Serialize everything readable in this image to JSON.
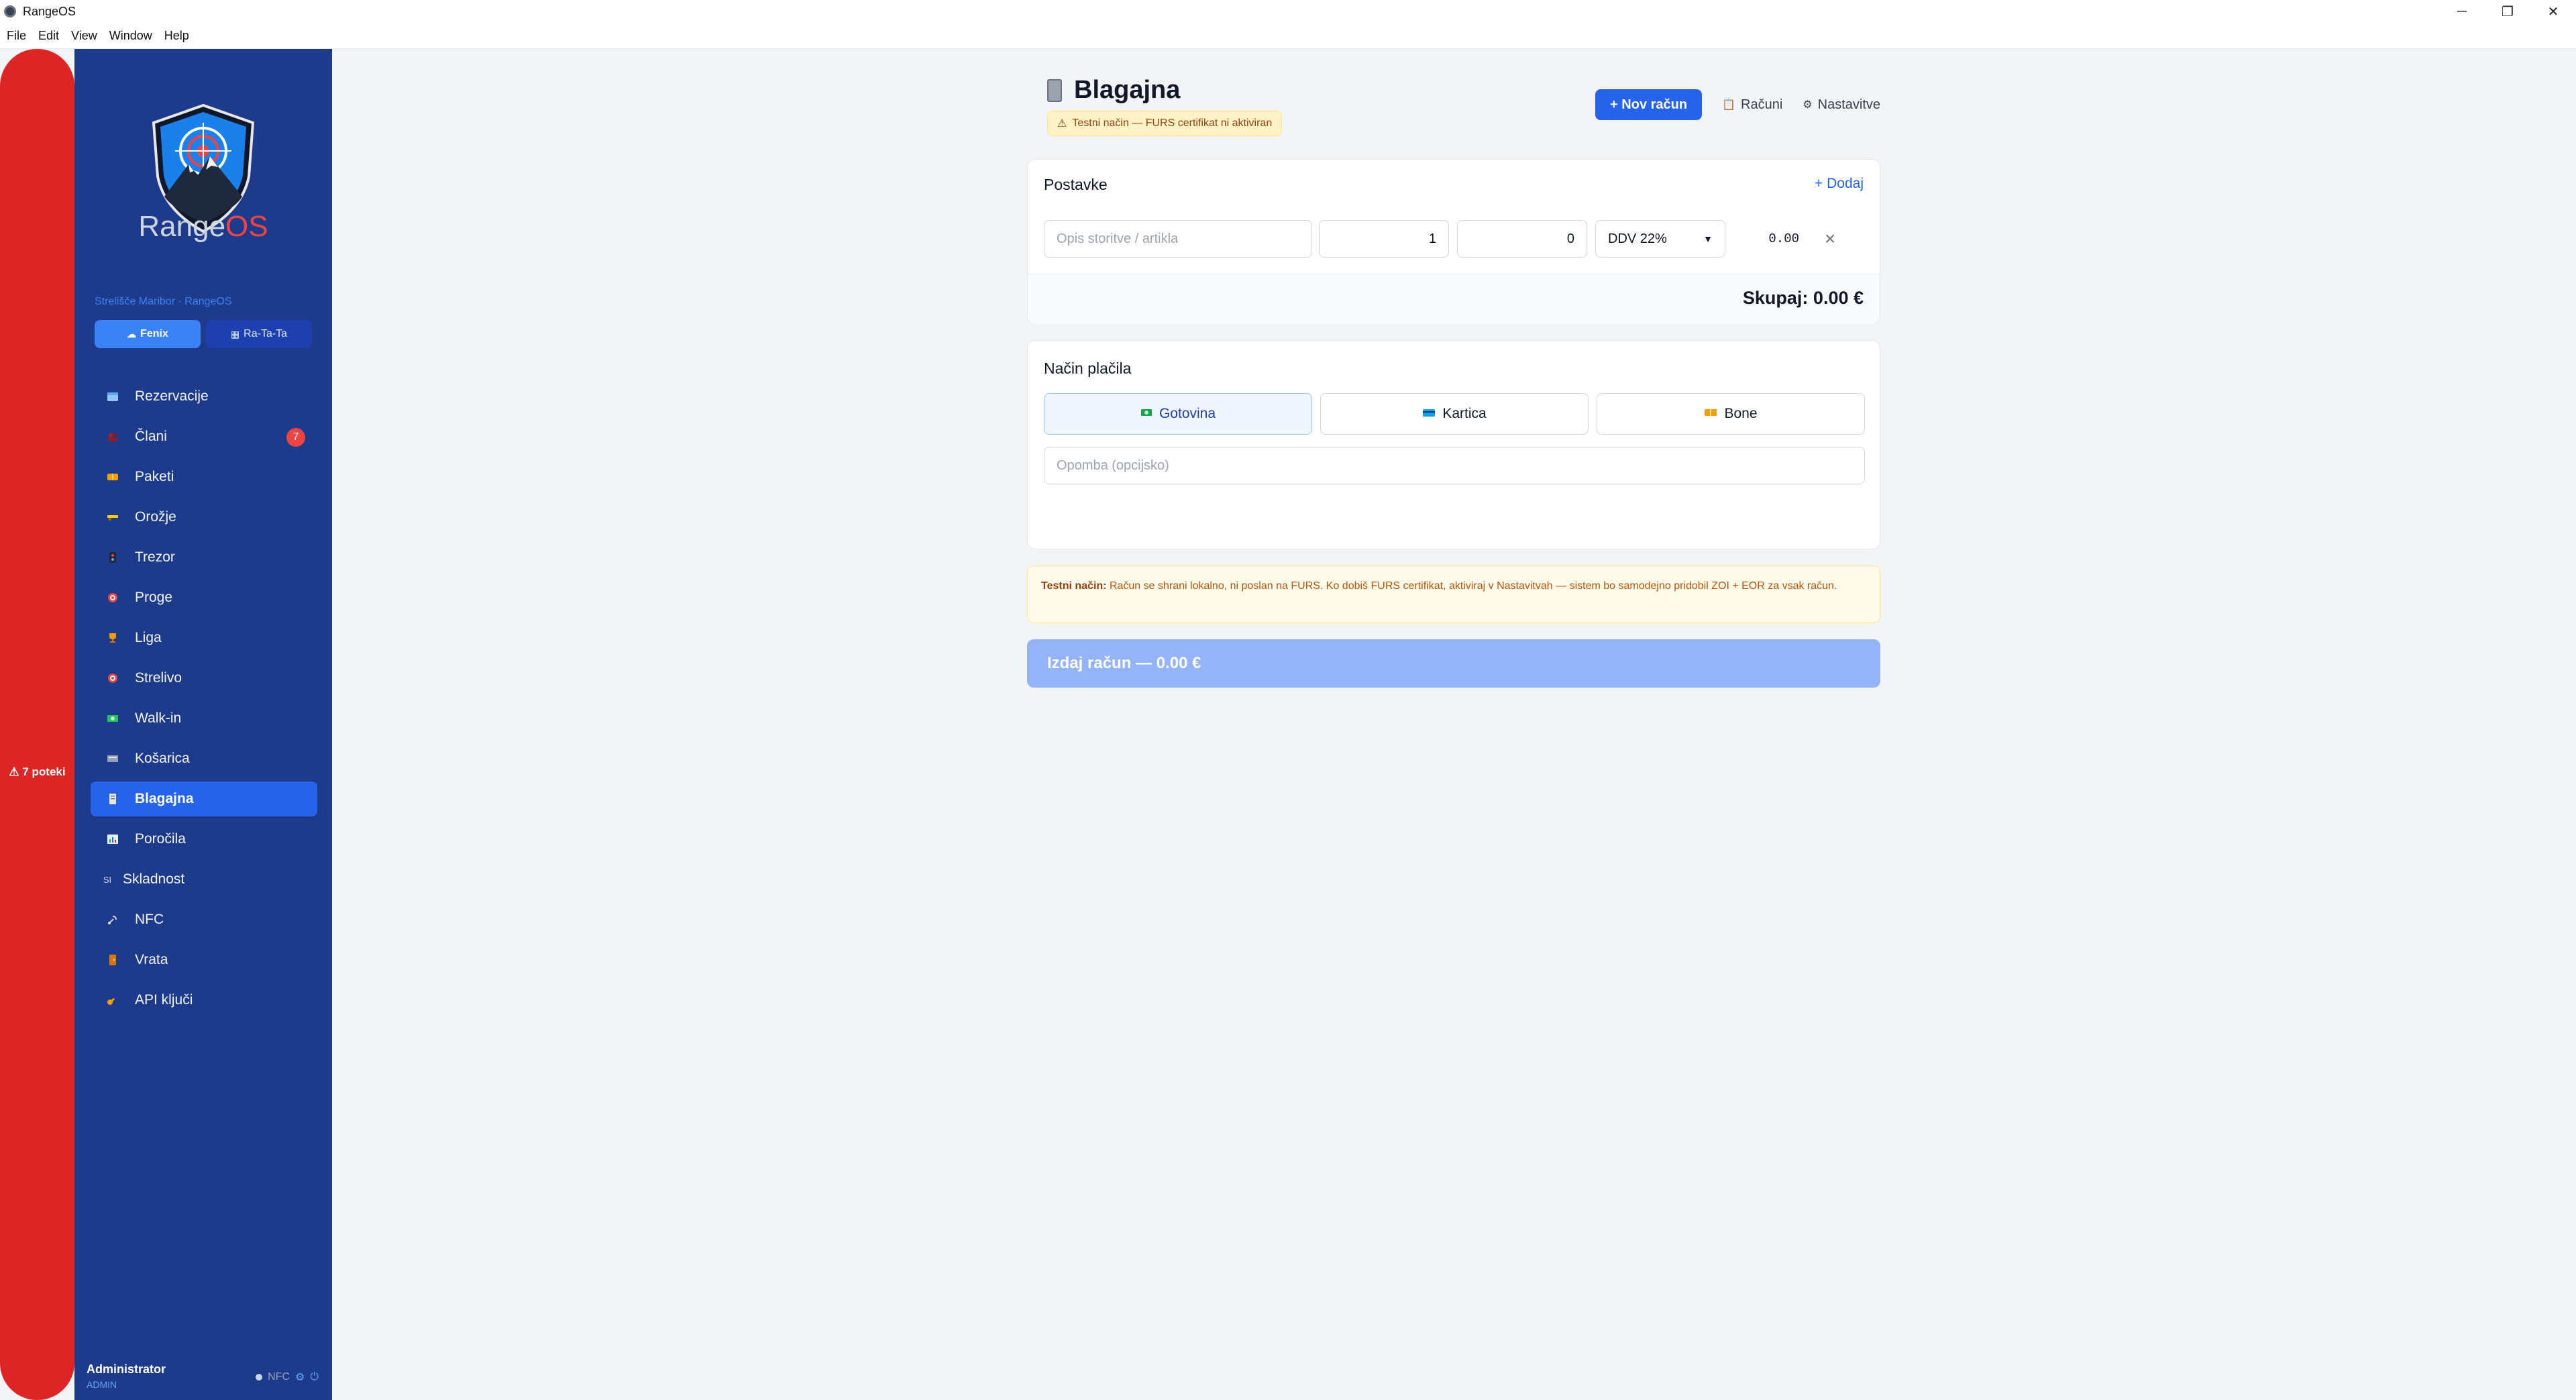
{
  "window": {
    "title": "RangeOS"
  },
  "menu": [
    "File",
    "Edit",
    "View",
    "Window",
    "Help"
  ],
  "window_controls": {
    "minimize": "─",
    "restore": "❐",
    "close": "✕"
  },
  "alert_rail": {
    "text": "⚠ 7 poteki",
    "color": "#dc2626"
  },
  "sidebar": {
    "logo_text_range": "Range",
    "logo_text_os": "OS",
    "org_name": "Strelišče Maribor · RangeOS",
    "ranges": [
      {
        "label": "Fenix",
        "icon": "cloud-icon",
        "active": true
      },
      {
        "label": "Ra-Ta-Ta",
        "icon": "building-icon",
        "active": false
      }
    ],
    "items": [
      {
        "label": "Rezervacije",
        "icon": "calendar-icon"
      },
      {
        "label": "Člani",
        "icon": "members-icon",
        "badge": "7"
      },
      {
        "label": "Paketi",
        "icon": "package-icon"
      },
      {
        "label": "Orožje",
        "icon": "weapon-icon"
      },
      {
        "label": "Trezor",
        "icon": "vault-icon"
      },
      {
        "label": "Proge",
        "icon": "target-icon"
      },
      {
        "label": "Liga",
        "icon": "trophy-icon"
      },
      {
        "label": "Strelivo",
        "icon": "ammo-icon"
      },
      {
        "label": "Walk-in",
        "icon": "cash-icon"
      },
      {
        "label": "Košarica",
        "icon": "cart-icon"
      },
      {
        "label": "Blagajna",
        "icon": "receipt-icon",
        "active": true
      },
      {
        "label": "Poročila",
        "icon": "report-icon"
      },
      {
        "label": "Skladnost",
        "icon": "compliance-icon",
        "icon_text": "SI"
      },
      {
        "label": "NFC",
        "icon": "nfc-icon"
      },
      {
        "label": "Vrata",
        "icon": "door-icon"
      },
      {
        "label": "API ključi",
        "icon": "key-icon"
      }
    ],
    "user": {
      "name": "Administrator",
      "role": "ADMIN"
    },
    "footer_status": {
      "nfc_label": "NFC"
    }
  },
  "main": {
    "title": "Blagajna",
    "test_badge": "Testni način — FURS certifikat ni aktiviran",
    "actions": {
      "new_receipt": "+ Nov račun",
      "receipts": "Računi",
      "settings": "Nastavitve"
    },
    "items_section": {
      "title": "Postavke",
      "add_label": "+ Dodaj",
      "row": {
        "description_placeholder": "Opis storitve / artikla",
        "quantity": "1",
        "price": "0",
        "vat": "DDV 22%",
        "line_total": "0.00"
      },
      "total_label": "Skupaj: 0.00 €"
    },
    "payment_section": {
      "title": "Način plačila",
      "options": [
        {
          "label": "Gotovina",
          "icon": "cash-icon",
          "selected": true
        },
        {
          "label": "Kartica",
          "icon": "card-icon",
          "selected": false
        },
        {
          "label": "Bone",
          "icon": "voucher-icon",
          "selected": false
        }
      ],
      "note_placeholder": "Opomba (opcijsko)"
    },
    "info": {
      "strong": "Testni način:",
      "text": " Račun se shrani lokalno, ni poslan na FURS. Ko dobiš FURS certifikat, aktiviraj v Nastavitvah — sistem bo samodejno pridobil ZOI + EOR za vsak račun."
    },
    "issue_button": "Izdaj račun — 0.00 €"
  },
  "colors": {
    "sidebar_bg": "#1e3a8a",
    "accent": "#2563eb",
    "alert": "#dc2626",
    "warning_bg": "#fef3c7"
  }
}
